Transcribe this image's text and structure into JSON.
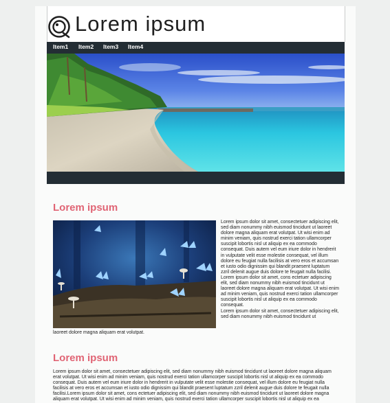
{
  "brand": {
    "logo_text": "Lorem  ipsum"
  },
  "nav": {
    "items": [
      {
        "label": "Item1"
      },
      {
        "label": "Item2"
      },
      {
        "label": "Item3"
      },
      {
        "label": "Item4"
      }
    ]
  },
  "section1": {
    "heading": "Lorem ipsum",
    "paragraphs": [
      "Lorem ipsum dolor sit amet, consectetuer adipiscing elit, sed diam nonummy nibh euismod tincidunt ut laoreet dolore magna aliquam erat volutpat. Ut wisi enim ad minim veniam, quis nostrud exerci tation ullamcorper suscipit lobortis nisl ut aliquip ex ea commodo consequat. Duis autem vel eum iriure dolor in hendrerit in vulputate velit esse molestie consequat, vel illum dolore eu feugiat nulla facilisis at vero eros et accumsan et iusto odio dignissim qui blandit praesent luptatum zzril delenit augue duis dolore te feugait nulla facilisi.",
      "Lorem ipsum dolor sit amet, cons ectetuer adipiscing elit, sed diam nonummy nibh euismod tincidunt ut laoreet dolore magna aliquam erat volutpat. Ut wisi enim ad minim veniam, quis nostrud exerci tation ullamcorper suscipit lobortis nisl ut aliquip ex ea commodo consequat.",
      "Lorem ipsum dolor sit amet, consectetuer adipiscing elit, sed diam nonummy nibh euismod tincidunt ut"
    ],
    "continuation": "laoreet dolore magna aliquam erat volutpat."
  },
  "section2": {
    "heading": "Lorem ipsum",
    "paragraph": "Lorem ipsum dolor sit amet, consectetuer adipiscing elit, sed diam nonummy nibh euismod tincidunt ut laoreet dolore magna aliquam erat volutpat. Ut wisi enim ad minim veniam, quis nostrud exerci tation ullamcorper suscipit lobortis nisl ut aliquip ex ea commodo consequat. Duis autem vel eum iriure dolor in hendrerit in vulputate velit esse molestie consequat, vel illum dolore eu feugiat nulla facilisis at vero eros et accumsan et iusto odio dignissim qui blandit praesent luptatum zzril delenit augue duis dolore te feugait nulla facilisi.Lorem ipsum dolor sit amet, cons ectetuer adipiscing elit, sed diam nonummy nibh euismod tincidunt ut laoreet dolore magna aliquam erat volutpat. Ut wisi enim ad minim veniam, quis nostrud exerci tation ullamcorper suscipit lobortis nisl ut aliquip ex ea commodo consequat."
  },
  "images": {
    "hero": "beach-photo",
    "media": "butterflies-mushrooms-photo"
  },
  "colors": {
    "accent": "#e06474",
    "nav_bg": "#232d34",
    "page_bg": "#fafbfa"
  }
}
